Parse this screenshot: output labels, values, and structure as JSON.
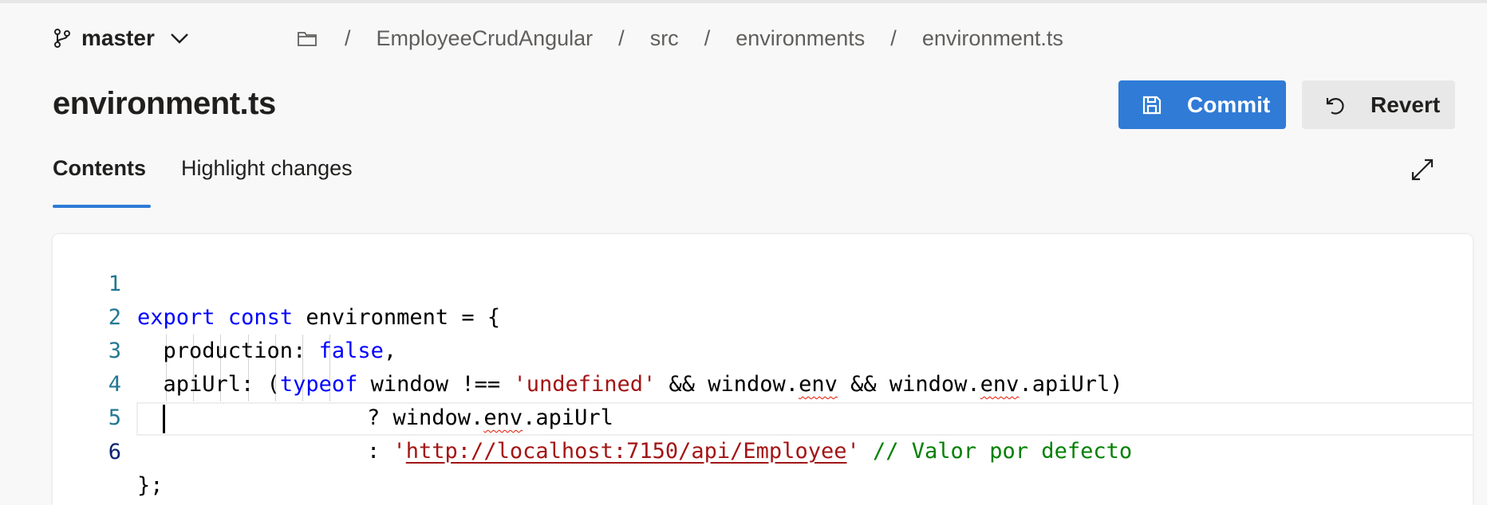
{
  "branch": {
    "name": "master",
    "icon": "branch-icon"
  },
  "breadcrumb": {
    "separator": "/",
    "parts": [
      "EmployeeCrudAngular",
      "src",
      "environments",
      "environment.ts"
    ]
  },
  "page_title": "environment.ts",
  "actions": {
    "commit_label": "Commit",
    "revert_label": "Revert",
    "commit_color": "#2f7bd6"
  },
  "tabs": [
    {
      "label": "Contents",
      "active": true
    },
    {
      "label": "Highlight changes",
      "active": false
    }
  ],
  "editor": {
    "language": "typescript",
    "line_numbers": [
      "1",
      "2",
      "3",
      "4",
      "5",
      "6"
    ],
    "lines": [
      "export const environment = {",
      "  production: false,",
      "  apiUrl: (typeof window !== 'undefined' && window.env && window.env.apiUrl)",
      "           ? window.env.apiUrl",
      "           : 'http://localhost:7150/api/Employee' // Valor por defecto",
      "};"
    ],
    "active_line": 6,
    "tokens": {
      "l1_kw1": "export",
      "l1_kw2": "const",
      "l1_rest": " environment = {",
      "l2_a": "  production: ",
      "l2_kw": "false",
      "l2_b": ",",
      "l3_a": "  apiUrl: (",
      "l3_kw": "typeof",
      "l3_b": " window !== ",
      "l3_str": "'undefined'",
      "l3_c": " && window.",
      "l3_env1": "env",
      "l3_d": " && window.",
      "l3_env2": "env",
      "l3_e": ".apiUrl)",
      "l4_a": "? window.",
      "l4_env": "env",
      "l4_b": ".apiUrl",
      "l5_a": ": ",
      "l5_q1": "'",
      "l5_url": "http://localhost:7150/api/Employee",
      "l5_q2": "'",
      "l5_cmt": " // Valor por defecto",
      "l6": "};"
    }
  }
}
